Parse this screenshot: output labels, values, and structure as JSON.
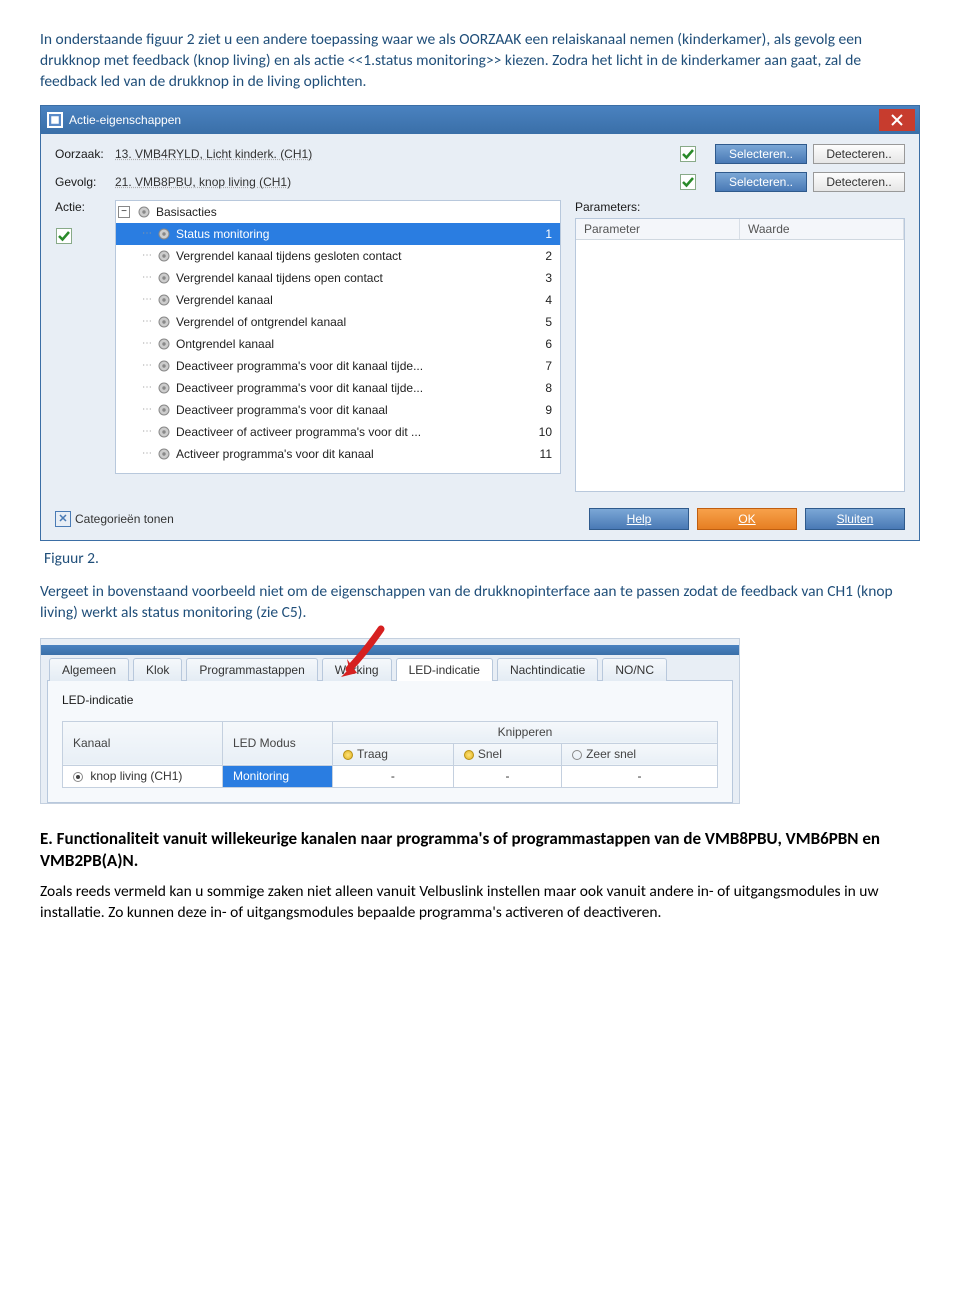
{
  "intro_text": "In onderstaande figuur 2 ziet u een andere toepassing waar we als OORZAAK een relaiskanaal nemen (kinderkamer), als gevolg een drukknop met feedback (knop living) en als actie <<1.status monitoring>> kiezen. Zodra het licht in de kinderkamer aan gaat, zal de feedback led van de drukknop in de living oplichten.",
  "dialog": {
    "title": "Actie-eigenschappen",
    "oorzaak_label": "Oorzaak:",
    "oorzaak_value": "13. VMB4RYLD, Licht kinderk. (CH1)",
    "gevolg_label": "Gevolg:",
    "gevolg_value": "21. VMB8PBU, knop living (CH1)",
    "actie_label": "Actie:",
    "parameters_label": "Parameters:",
    "select_btn": "Selecteren..",
    "detect_btn": "Detecteren..",
    "tree_root": "Basisacties",
    "tree_items": [
      {
        "label": "Status monitoring",
        "num": "1",
        "selected": true
      },
      {
        "label": "Vergrendel kanaal tijdens gesloten contact",
        "num": "2"
      },
      {
        "label": "Vergrendel kanaal tijdens open contact",
        "num": "3"
      },
      {
        "label": "Vergrendel kanaal",
        "num": "4"
      },
      {
        "label": "Vergrendel of ontgrendel kanaal",
        "num": "5"
      },
      {
        "label": "Ontgrendel kanaal",
        "num": "6"
      },
      {
        "label": "Deactiveer programma's voor dit kanaal tijde...",
        "num": "7"
      },
      {
        "label": "Deactiveer programma's voor dit kanaal tijde...",
        "num": "8"
      },
      {
        "label": "Deactiveer programma's voor dit kanaal",
        "num": "9"
      },
      {
        "label": "Deactiveer of activeer programma's voor dit ...",
        "num": "10"
      },
      {
        "label": "Activeer programma's voor dit kanaal",
        "num": "11"
      }
    ],
    "param_col1": "Parameter",
    "param_col2": "Waarde",
    "categories_btn": "Categorieën tonen",
    "help_btn": "Help",
    "ok_btn": "OK",
    "close_btn": "Sluiten"
  },
  "fig_caption": "Figuur 2.",
  "desc_text": "Vergeet in bovenstaand voorbeeld niet om de eigenschappen van de drukknopinterface aan te passen zodat de feedback van CH1 (knop living) werkt als status monitoring (zie C5).",
  "tabs": {
    "list": [
      "Algemeen",
      "Klok",
      "Programmastappen",
      "Werking",
      "LED-indicatie",
      "Nachtindicatie",
      "NO/NC"
    ],
    "active": "LED-indicatie",
    "section_label": "LED-indicatie",
    "col_kanaal": "Kanaal",
    "col_ledmodus": "LED Modus",
    "col_knipperen": "Knipperen",
    "col_traag": "Traag",
    "col_snel": "Snel",
    "col_zeersnel": "Zeer snel",
    "row_kanaal": "knop living (CH1)",
    "row_modus": "Monitoring",
    "dash": "-"
  },
  "heading_e": "E. Functionaliteit vanuit willekeurige kanalen naar programma's of programmastappen van de VMB8PBU, VMB6PBN en VMB2PB(A)N.",
  "body_e": "Zoals reeds vermeld kan u sommige zaken niet alleen vanuit Velbuslink instellen maar ook vanuit andere in- of uitgangsmodules in uw installatie. Zo kunnen deze in- of uitgangsmodules bepaalde programma's activeren of deactiveren."
}
